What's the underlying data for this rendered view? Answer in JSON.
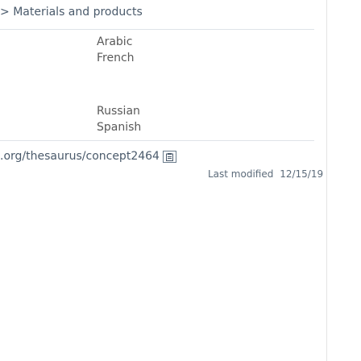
{
  "breadcrumb": {
    "prefix": "",
    "separator": ">",
    "current": "Materials and products"
  },
  "languages_group_1": [
    "Arabic",
    "French"
  ],
  "languages_group_2": [
    "Russian",
    "Spanish"
  ],
  "concept": {
    "uri_text": ".org/thesaurus/concept2464",
    "copy_icon": "copy-clipboard-icon"
  },
  "modified": {
    "label": "Last modified",
    "date": "12/15/19"
  },
  "colors": {
    "text": "#595959",
    "link": "#4a5a6b",
    "rule": "#dfe3e8"
  }
}
